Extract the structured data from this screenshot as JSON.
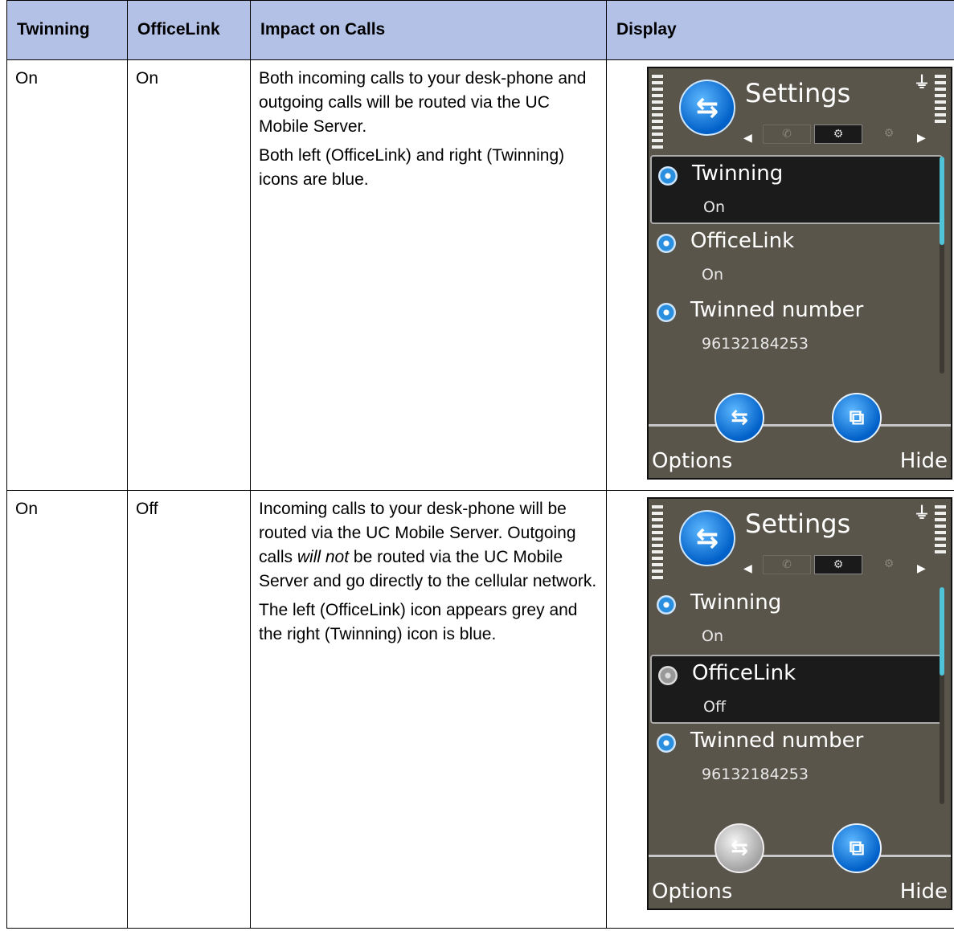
{
  "headers": [
    "Twinning",
    "OfficeLink",
    "Impact on Calls",
    "Display"
  ],
  "rows": [
    {
      "twinning": "On",
      "officelink": "On",
      "impact_paragraphs": [
        "Both incoming calls to your desk-phone and outgoing calls will be routed via the UC Mobile Server.",
        "Both left (OfficeLink) and right (Twinning) icons are blue."
      ],
      "display": {
        "title": "Settings",
        "items": [
          {
            "name": "Twinning",
            "value": "On",
            "selected": true,
            "icon": "settings-dot-blue-icon"
          },
          {
            "name": "OfficeLink",
            "value": "On",
            "selected": false,
            "icon": "settings-dot-blue-icon"
          },
          {
            "name": "Twinned number",
            "value": "96132184253",
            "selected": false,
            "icon": "settings-dot-blue-icon"
          }
        ],
        "soft_left": "Options",
        "soft_right": "Hide",
        "officelink_icon_color": "blue",
        "twinning_icon_color": "blue"
      }
    },
    {
      "twinning": "On",
      "officelink": "Off",
      "impact_1_pre": "Incoming calls to your desk-phone will be routed via the UC Mobile Server. Outgoing calls ",
      "impact_1_em": "will not",
      "impact_1_post": " be routed via the UC Mobile Server and go directly to the cellular network.",
      "impact_2": "The left (OfficeLink) icon appears grey and the right (Twinning) icon is blue.",
      "display": {
        "title": "Settings",
        "items": [
          {
            "name": "Twinning",
            "value": "On",
            "selected": false,
            "icon": "settings-dot-blue-icon"
          },
          {
            "name": "OfficeLink",
            "value": "Off",
            "selected": true,
            "icon": "settings-dot-grey-icon"
          },
          {
            "name": "Twinned number",
            "value": "96132184253",
            "selected": false,
            "icon": "settings-dot-blue-icon"
          }
        ],
        "soft_left": "Options",
        "soft_right": "Hide",
        "officelink_icon_color": "grey",
        "twinning_icon_color": "blue"
      }
    }
  ],
  "colors": {
    "header_bg": "#b3c1e6",
    "screen_bg": "#5a554a",
    "icon_blue": "#0060c8"
  }
}
